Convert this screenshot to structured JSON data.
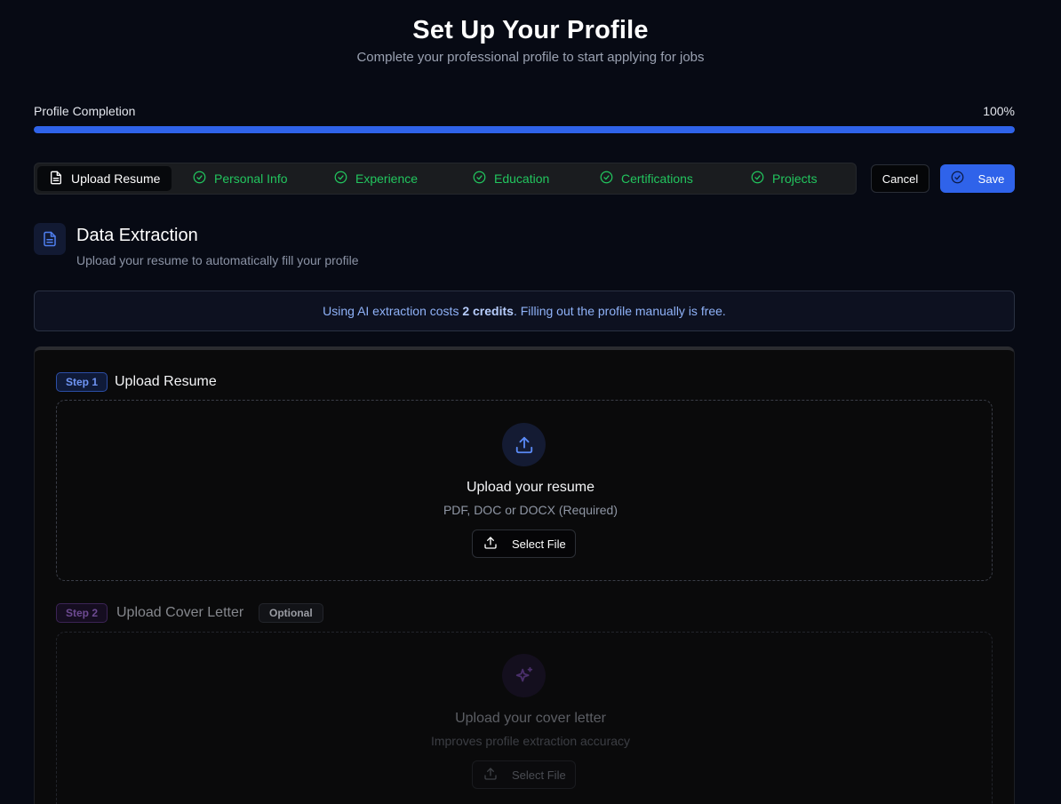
{
  "header": {
    "title": "Set Up Your Profile",
    "subtitle": "Complete your professional profile to start applying for jobs"
  },
  "progress": {
    "label": "Profile Completion",
    "value_text": "100%",
    "value": 1.0
  },
  "tabs": [
    {
      "label": "Upload Resume",
      "icon": "document-icon",
      "active": true
    },
    {
      "label": "Personal Info",
      "icon": "check-circle-icon",
      "completed": true
    },
    {
      "label": "Experience",
      "icon": "check-circle-icon",
      "completed": true
    },
    {
      "label": "Education",
      "icon": "check-circle-icon",
      "completed": true
    },
    {
      "label": "Certifications",
      "icon": "check-circle-icon",
      "completed": true
    },
    {
      "label": "Projects",
      "icon": "check-circle-icon",
      "completed": true
    }
  ],
  "actions": {
    "cancel_label": "Cancel",
    "save_label": "Save"
  },
  "section": {
    "title": "Data Extraction",
    "subtitle": "Upload your resume to automatically fill your profile"
  },
  "info": {
    "prefix": "Using AI extraction costs ",
    "credits": "2 credits",
    "suffix": ". Filling out the profile manually is free."
  },
  "step1": {
    "badge": "Step 1",
    "title": "Upload Resume",
    "dropzone_title": "Upload your resume",
    "dropzone_sub": "PDF, DOC or DOCX (Required)",
    "button_label": "Select File"
  },
  "step2": {
    "badge": "Step 2",
    "title": "Upload Cover Letter",
    "optional_label": "Optional",
    "dropzone_title": "Upload your cover letter",
    "dropzone_sub": "Improves profile extraction accuracy",
    "button_label": "Select File"
  },
  "colors": {
    "background": "#070a14",
    "accent": "#2f63ea",
    "success": "#22c55e",
    "info_text": "#8fb2f8",
    "step2_accent": "#6d4a92"
  }
}
